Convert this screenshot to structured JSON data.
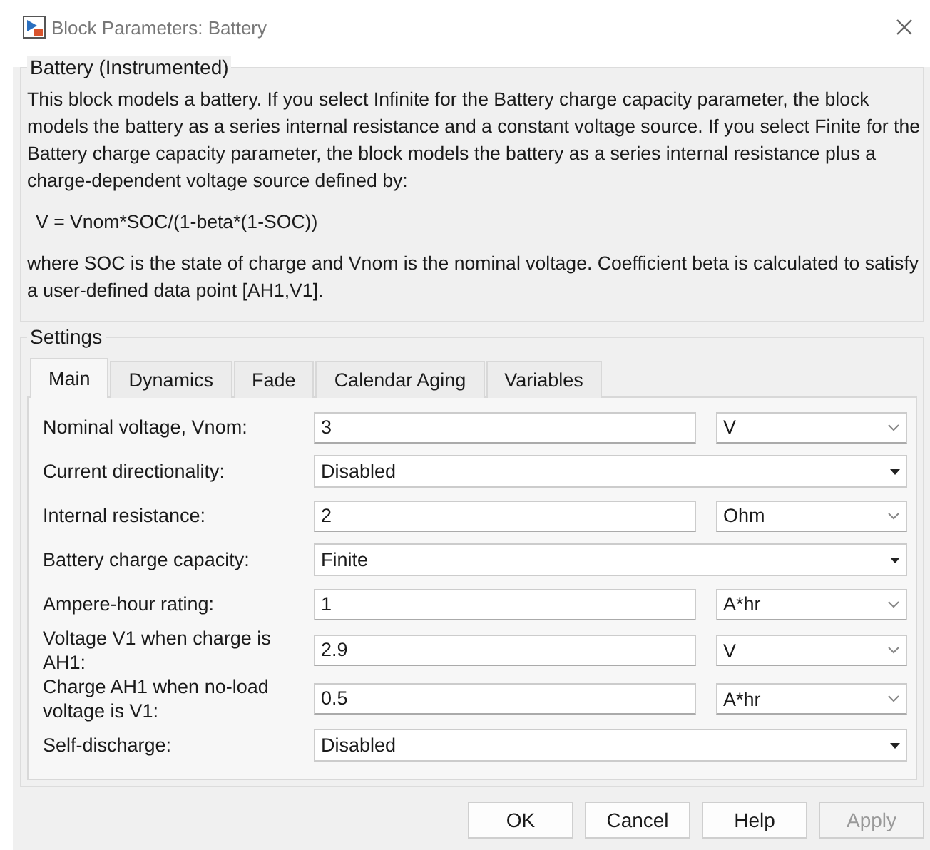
{
  "window": {
    "title": "Block Parameters: Battery"
  },
  "description": {
    "title": "Battery (Instrumented)",
    "paragraphs": [
      "This block models a battery. If you select Infinite for the Battery charge capacity parameter, the block models the battery as a series internal resistance and a constant voltage source. If you select Finite for the Battery charge capacity parameter, the block models the battery as a series internal resistance plus a charge-dependent voltage source defined by:",
      "V = Vnom*SOC/(1-beta*(1-SOC))",
      "where SOC is the state of charge and Vnom is the nominal voltage. Coefficient beta is calculated to satisfy a user-defined data point [AH1,V1]."
    ]
  },
  "settings": {
    "title": "Settings",
    "tabs": [
      {
        "label": "Main",
        "selected": true
      },
      {
        "label": "Dynamics",
        "selected": false
      },
      {
        "label": "Fade",
        "selected": false
      },
      {
        "label": "Calendar Aging",
        "selected": false
      },
      {
        "label": "Variables",
        "selected": false
      }
    ],
    "rows": [
      {
        "kind": "value_unit",
        "label": "Nominal voltage, Vnom:",
        "value": "3",
        "unit": "V"
      },
      {
        "kind": "dropdown",
        "label": "Current directionality:",
        "value": "Disabled"
      },
      {
        "kind": "value_unit",
        "label": "Internal resistance:",
        "value": "2",
        "unit": "Ohm"
      },
      {
        "kind": "dropdown",
        "label": "Battery charge capacity:",
        "value": "Finite"
      },
      {
        "kind": "value_unit",
        "label": "Ampere-hour rating:",
        "value": "1",
        "unit": "A*hr"
      },
      {
        "kind": "value_unit",
        "label": "Voltage V1 when charge is AH1:",
        "value": "2.9",
        "unit": "V"
      },
      {
        "kind": "value_unit",
        "label": "Charge AH1 when no-load voltage is V1:",
        "value": "0.5",
        "unit": "A*hr"
      },
      {
        "kind": "dropdown",
        "label": "Self-discharge:",
        "value": "Disabled"
      }
    ]
  },
  "buttons": [
    {
      "label": "OK",
      "disabled": false
    },
    {
      "label": "Cancel",
      "disabled": false
    },
    {
      "label": "Help",
      "disabled": false
    },
    {
      "label": "Apply",
      "disabled": true
    }
  ]
}
